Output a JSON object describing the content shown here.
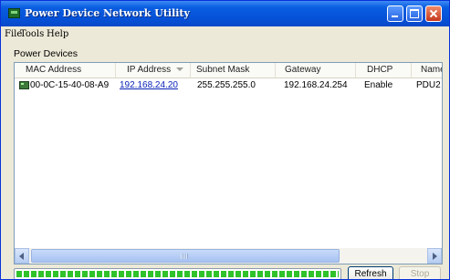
{
  "window": {
    "title": "Power Device Network Utility"
  },
  "menu": [
    {
      "label": "File"
    },
    {
      "label": "Tools"
    },
    {
      "label": "Help"
    }
  ],
  "group": {
    "label": "Power Devices"
  },
  "table": {
    "columns": [
      {
        "label": "MAC Address"
      },
      {
        "label": "IP Address"
      },
      {
        "label": "Subnet Mask"
      },
      {
        "label": "Gateway"
      },
      {
        "label": "DHCP"
      },
      {
        "label": "Name"
      }
    ],
    "sorted_column": "IP Address",
    "rows": [
      {
        "mac": "00-0C-15-40-08-A9",
        "ip": "192.168.24.20",
        "subnet": "255.255.255.0",
        "gateway": "192.168.24.254",
        "dhcp": "Enable",
        "name": "PDU2"
      }
    ]
  },
  "progress": {
    "value_percent": 100,
    "color": "#2fc22a"
  },
  "buttons": {
    "refresh": "Refresh",
    "stop": "Stop"
  },
  "colors": {
    "titlebar": "#0551d8",
    "link": "#0b24b8"
  }
}
